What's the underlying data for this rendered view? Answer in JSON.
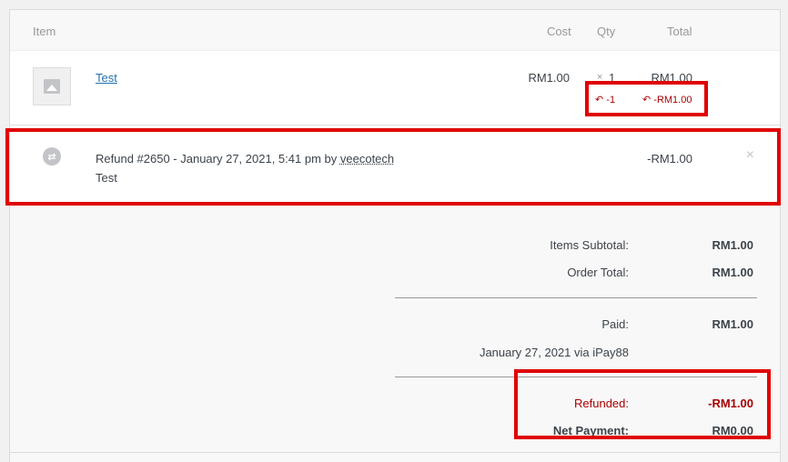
{
  "headers": {
    "item": "Item",
    "cost": "Cost",
    "qty": "Qty",
    "total": "Total"
  },
  "line_item": {
    "name": "Test",
    "cost": "RM1.00",
    "qty_symbol": "×",
    "qty": "1",
    "total": "RM1.00",
    "refunded_qty": "-1",
    "refunded_total": "-RM1.00",
    "thumbnail_icon": "image-placeholder-icon"
  },
  "refund": {
    "icon": "refund-icon",
    "title_prefix": "Refund #2650 - January 27, 2021, 5:41 pm by",
    "author": "veecotech",
    "note": "Test",
    "amount": "-RM1.00",
    "close_icon": "×"
  },
  "totals": {
    "items_subtotal_label": "Items Subtotal:",
    "items_subtotal": "RM1.00",
    "order_total_label": "Order Total:",
    "order_total": "RM1.00",
    "paid_label": "Paid:",
    "paid": "RM1.00",
    "paid_note": "January 27, 2021 via iPay88",
    "refunded_label": "Refunded:",
    "refunded": "-RM1.00",
    "net_payment_label": "Net Payment:",
    "net_payment": "RM0.00"
  },
  "colors": {
    "refund_red": "#aa0000",
    "highlight_red": "#e00000",
    "link_blue": "#2271b1"
  }
}
